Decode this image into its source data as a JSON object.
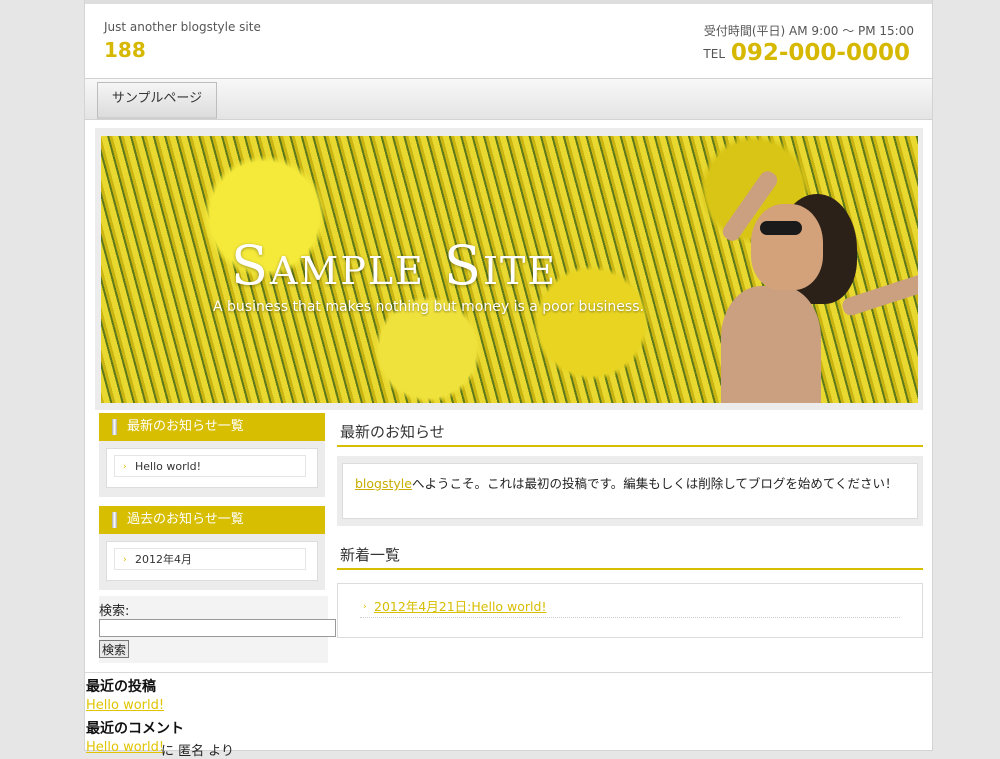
{
  "header": {
    "tagline": "Just another blogstyle site",
    "site_number": "188",
    "hours": "受付時間(平日) AM 9:00 ～ PM 15:00",
    "tel_label": "TEL",
    "tel_number": "092-000-0000"
  },
  "nav": {
    "items": [
      {
        "label": "サンプルページ"
      }
    ]
  },
  "hero": {
    "title": "Sample Site",
    "subtitle": "A business that makes nothing but money is a poor business."
  },
  "sidebar": {
    "widgets": [
      {
        "title": "最新のお知らせ一覧",
        "items": [
          "Hello world!"
        ]
      },
      {
        "title": "過去のお知らせ一覧",
        "items": [
          "2012年4月"
        ]
      }
    ],
    "search": {
      "label": "検索:",
      "value": "",
      "button": "検索"
    }
  },
  "main": {
    "news_heading": "最新のお知らせ",
    "news_link": "blogstyle",
    "news_text": "へようこそ。これは最初の投稿です。編集もしくは削除してブログを始めてください！",
    "recent_heading": "新着一覧",
    "recent_items": [
      "2012年4月21日:Hello world!"
    ]
  },
  "footer_widgets": {
    "recent_posts_heading": "最近の投稿",
    "recent_posts": [
      "Hello world!"
    ],
    "recent_comments_heading": "最近のコメント",
    "comment_link": "Hello world!",
    "comment_text": " に 匿名 より"
  },
  "colors": {
    "accent": "#d7be00",
    "link": "#d7b800",
    "background": "#e6e6e6"
  }
}
